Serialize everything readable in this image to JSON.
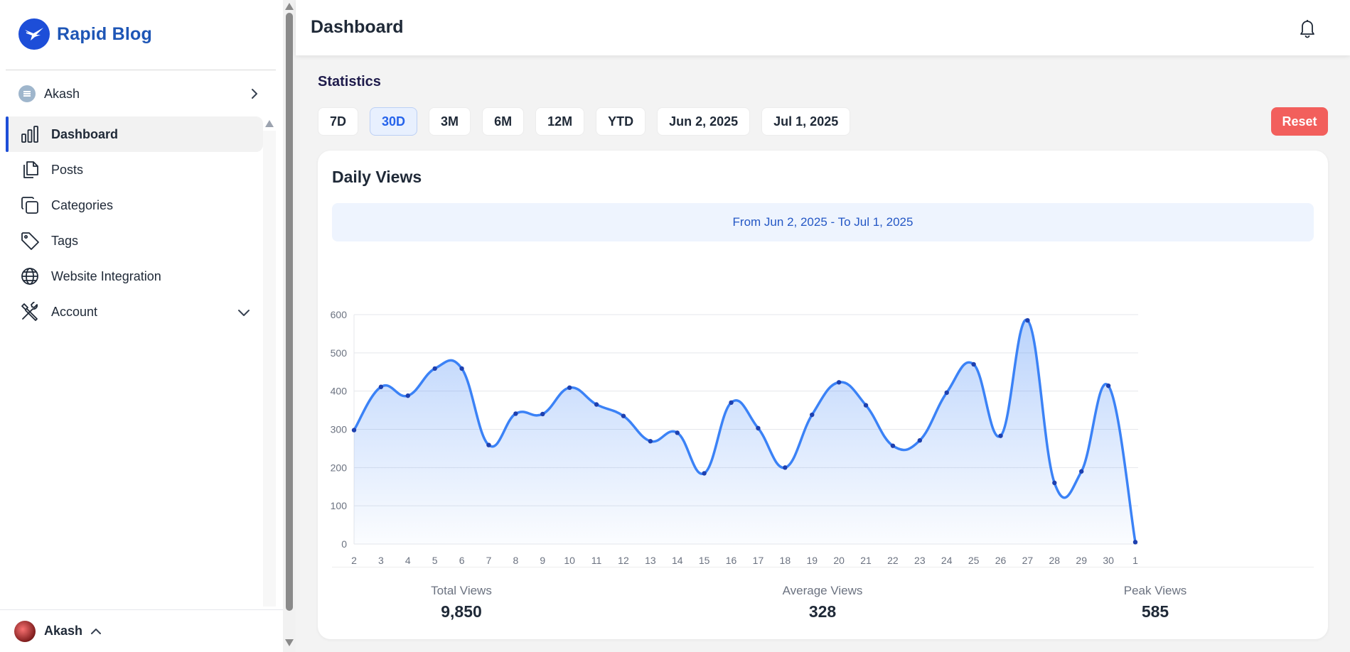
{
  "brand": {
    "name": "Rapid Blog"
  },
  "workspace": {
    "name": "Akash"
  },
  "nav": {
    "items": [
      {
        "label": "Dashboard",
        "icon": "bar-chart-icon"
      },
      {
        "label": "Posts",
        "icon": "documents-icon"
      },
      {
        "label": "Categories",
        "icon": "copy-icon"
      },
      {
        "label": "Tags",
        "icon": "tag-icon"
      },
      {
        "label": "Website Integration",
        "icon": "globe-icon"
      },
      {
        "label": "Account",
        "icon": "tools-icon"
      }
    ],
    "active": "Dashboard"
  },
  "user": {
    "name": "Akash"
  },
  "header": {
    "title": "Dashboard"
  },
  "stats": {
    "title": "Statistics",
    "ranges": [
      "7D",
      "30D",
      "3M",
      "6M",
      "12M",
      "YTD",
      "Jun 2, 2025",
      "Jul 1, 2025"
    ],
    "active_range": "30D",
    "reset_label": "Reset"
  },
  "card": {
    "title": "Daily Views",
    "range_text": "From Jun 2, 2025 - To Jul 1, 2025"
  },
  "summary": {
    "total_label": "Total Views",
    "total_value": "9,850",
    "avg_label": "Average Views",
    "avg_value": "328",
    "peak_label": "Peak Views",
    "peak_value": "585"
  },
  "colors": {
    "accent": "#1d4ed8",
    "line": "#3b82f6",
    "reset": "#f25f5c"
  },
  "chart_data": {
    "type": "area",
    "categories": [
      "2",
      "3",
      "4",
      "5",
      "6",
      "7",
      "8",
      "9",
      "10",
      "11",
      "12",
      "13",
      "14",
      "15",
      "16",
      "17",
      "18",
      "19",
      "20",
      "21",
      "22",
      "23",
      "24",
      "25",
      "26",
      "27",
      "28",
      "29",
      "30",
      "1"
    ],
    "series": [
      {
        "values": [
          298,
          411,
          388,
          459,
          459,
          259,
          341,
          340,
          409,
          365,
          335,
          269,
          291,
          185,
          370,
          303,
          200,
          338,
          423,
          363,
          257,
          271,
          396,
          470,
          283,
          585,
          160,
          190,
          414,
          5
        ]
      }
    ],
    "ylim": [
      0,
      600
    ],
    "yticks": [
      0,
      100,
      200,
      300,
      400,
      500,
      600
    ],
    "grid": true
  }
}
